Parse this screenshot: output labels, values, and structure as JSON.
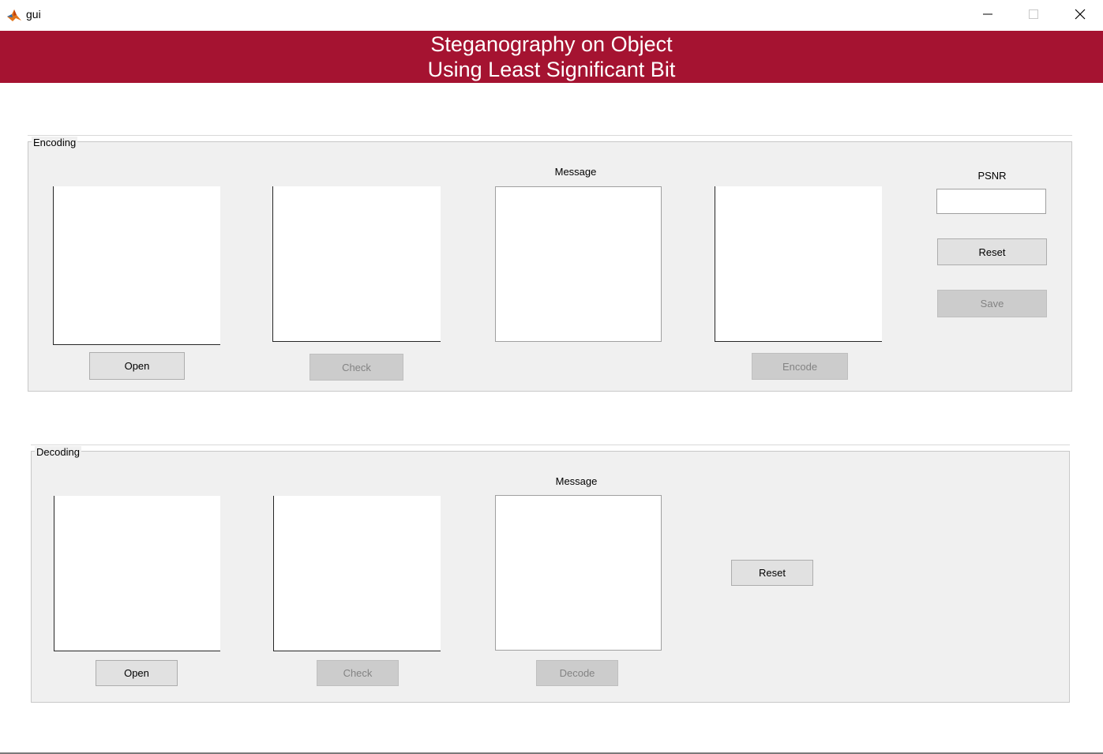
{
  "window": {
    "title": "gui"
  },
  "banner": {
    "line1": "Steganography on Object",
    "line2": "Using Least Significant Bit",
    "color": "#a51331"
  },
  "encoding": {
    "title": "Encoding",
    "message_label": "Message",
    "psnr_label": "PSNR",
    "psnr_value": "",
    "open_label": "Open",
    "check_label": "Check",
    "encode_label": "Encode",
    "reset_label": "Reset",
    "save_label": "Save"
  },
  "decoding": {
    "title": "Decoding",
    "message_label": "Message",
    "open_label": "Open",
    "check_label": "Check",
    "decode_label": "Decode",
    "reset_label": "Reset"
  }
}
